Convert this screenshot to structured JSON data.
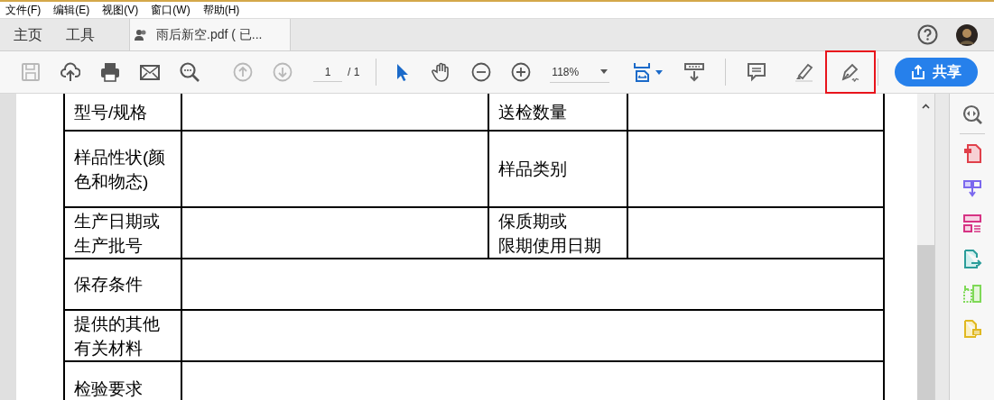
{
  "menu_bar": [
    "文件(F)",
    "编辑(E)",
    "视图(V)",
    "窗口(W)",
    "帮助(H)"
  ],
  "tabs": [
    {
      "label": "主页",
      "selected": false
    },
    {
      "label": "工具",
      "selected": false
    }
  ],
  "document_tab": {
    "title": "雨后新空.pdf ( 已...",
    "selected": true
  },
  "toolbar": {
    "left_tools": [
      {
        "kind": "save",
        "disabled": true
      },
      {
        "kind": "upload",
        "disabled": false
      },
      {
        "kind": "print",
        "disabled": false
      },
      {
        "kind": "mail",
        "disabled": false
      },
      {
        "kind": "search",
        "disabled": false
      },
      {
        "kind": "up",
        "disabled": true
      },
      {
        "kind": "down",
        "disabled": true
      }
    ],
    "page_field": {
      "value": "1"
    },
    "page_total": "/ 1",
    "view_tools": [
      {
        "kind": "pointer",
        "selected": true
      },
      {
        "kind": "hand",
        "selected": false
      },
      {
        "kind": "zoom-out",
        "selected": false
      },
      {
        "kind": "zoom-in",
        "selected": false
      }
    ],
    "zoom": {
      "value": "118%"
    },
    "right_tools": [
      {
        "kind": "fit",
        "highlighted": false
      },
      {
        "kind": "scroll",
        "highlighted": false
      },
      {
        "kind": "comment",
        "highlighted": false
      },
      {
        "kind": "highlighter",
        "highlighted": false
      },
      {
        "kind": "sign",
        "highlighted": true
      }
    ],
    "share_button": "共享"
  },
  "table": {
    "rows": [
      {
        "labels": [
          [
            "型号/规格"
          ],
          [
            "送检数量"
          ]
        ]
      },
      {
        "labels": [
          [
            "样品性状(颜色和物态)"
          ],
          [
            "样品类别"
          ]
        ]
      },
      {
        "labels": [
          [
            "生产日期或生产批号"
          ],
          [
            "保质期或",
            "限期使用日期"
          ]
        ]
      },
      {
        "labels": [
          [
            "保存条件"
          ]
        ]
      },
      {
        "labels": [
          [
            "提供的其他有关材料"
          ]
        ]
      },
      {
        "labels": [
          [
            "检验要求"
          ]
        ]
      }
    ]
  },
  "side_panel": [
    {
      "kind": "zoom-pan",
      "color": "#616161"
    },
    {
      "kind": "create-pdf",
      "color": "#e0404a"
    },
    {
      "kind": "combine",
      "color": "#7b68ee"
    },
    {
      "kind": "organize",
      "color": "#d63384"
    },
    {
      "kind": "export",
      "color": "#2a9d9a"
    },
    {
      "kind": "compare",
      "color": "#7ed957"
    },
    {
      "kind": "comment",
      "color": "#e0b820"
    }
  ]
}
